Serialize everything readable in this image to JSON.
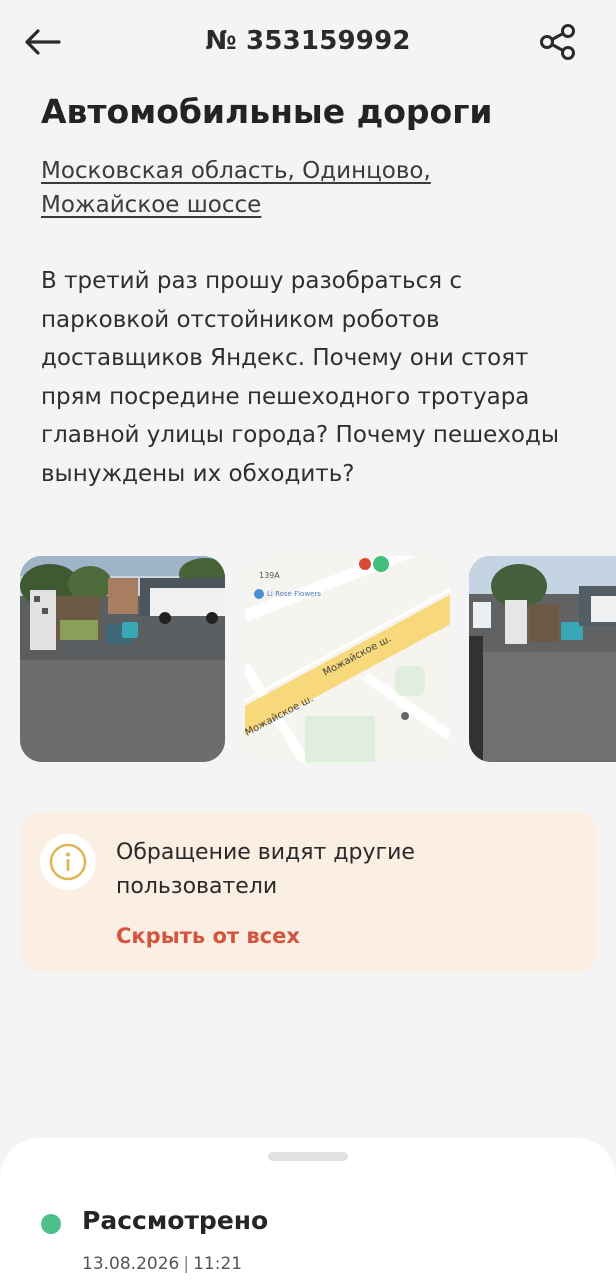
{
  "header": {
    "title": "№ 353159992",
    "back_icon": "arrow-left-icon",
    "share_icon": "share-icon"
  },
  "appeal": {
    "category": "Автомобильные дороги",
    "address": "Московская область, Одинцово, Можайское шоссе",
    "description": "В третий раз прошу разобраться с парковкой отстойником роботов доставщиков Яндекс. Почему они стоят прям посредине пешеходного тротуара главной улицы города? Почему пешеходы вынуждены их обходить?"
  },
  "photos": [
    {
      "kind": "street-photo"
    },
    {
      "kind": "map-snippet",
      "labels": [
        "139А",
        "Li Rose Flowers",
        "Можайское ш.",
        "Можайское ш."
      ]
    },
    {
      "kind": "street-photo"
    }
  ],
  "visibility_notice": {
    "icon": "info-icon",
    "text": "Обращение видят другие пользователи",
    "action_label": "Скрыть от всех"
  },
  "status": {
    "label": "Рассмотрено",
    "date": "13.08.2026",
    "time": "11:21",
    "dot_color": "#4fbf8a"
  },
  "colors": {
    "background": "#f4f4f4",
    "notice_background": "#fbeee3",
    "accent_link": "#d4553e",
    "info_icon": "#e0b552"
  }
}
